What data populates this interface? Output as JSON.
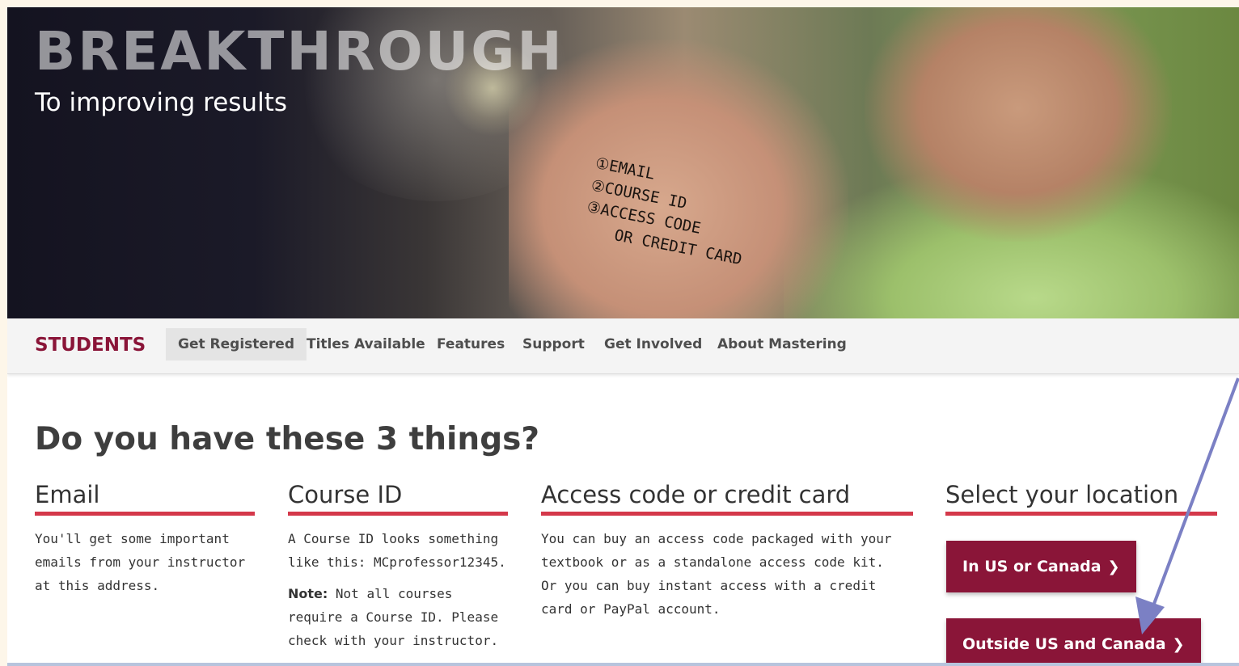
{
  "hero": {
    "title": "BREAKTHROUGH",
    "subtitle": "To improving results",
    "palm_notes": [
      "①EMAIL",
      "②COURSE ID",
      "③ACCESS CODE",
      "OR CREDIT CARD"
    ]
  },
  "nav": {
    "brand": "STUDENTS",
    "items": [
      "Get Registered",
      "Titles Available",
      "Features",
      "Support",
      "Get Involved",
      "About Mastering"
    ],
    "active": "Get Registered"
  },
  "main": {
    "heading": "Do you have these 3 things?",
    "columns": [
      {
        "title": "Email",
        "text": "You'll get some important emails from your instructor at this address."
      },
      {
        "title": "Course ID",
        "text": "A Course ID looks something like this: MCprofessor12345.",
        "note_label": "Note:",
        "note_text": " Not all courses require a Course ID. Please check with your instructor."
      },
      {
        "title": "Access code or credit card",
        "text": "You can buy an access code packaged with your textbook or as a standalone access code kit. Or you can buy instant access with a credit card or PayPal account."
      },
      {
        "title": "Select your location"
      }
    ],
    "location_buttons": {
      "us_canada": "In US or Canada",
      "outside": "Outside US and Canada"
    }
  },
  "colors": {
    "brand": "#8a1538",
    "underline": "#d4384a",
    "annotation_arrow": "#7b80c4"
  },
  "icons": {
    "chevron": "chevron-right-icon"
  }
}
